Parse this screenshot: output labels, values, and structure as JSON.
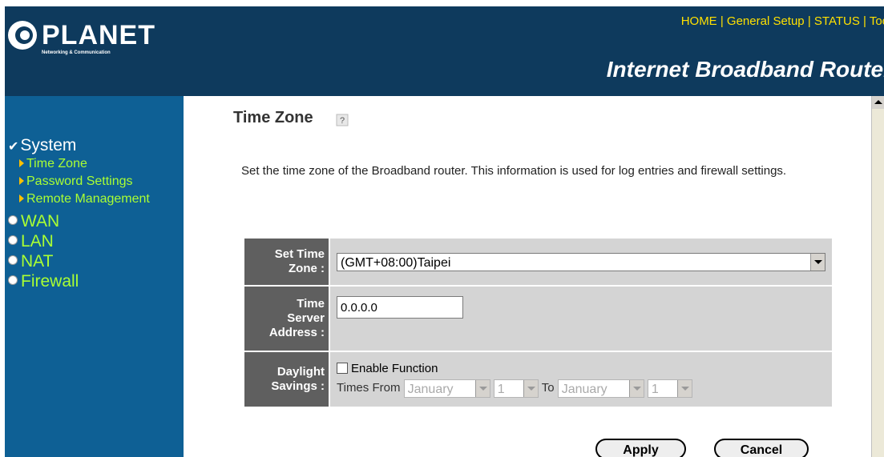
{
  "header": {
    "logo_text": "PLANET",
    "logo_subtext": "Networking & Communication",
    "nav": [
      "HOME",
      "General Setup",
      "STATUS",
      "Too"
    ],
    "nav_sep": " | ",
    "product_name": "Internet Broadband Router",
    "colors": {
      "background": "#0e3a5d",
      "nav": "#ffe000"
    }
  },
  "sidebar": {
    "system": "System",
    "system_items": [
      "Time Zone",
      "Password Settings",
      "Remote Management"
    ],
    "wan": "WAN",
    "lan": "LAN",
    "nat": "NAT",
    "firewall": "Firewall",
    "colors": {
      "background": "#0e6095",
      "active": "#aaff33"
    }
  },
  "main": {
    "title": "Time Zone",
    "help_icon": "help-icon",
    "description": "Set the time zone of the Broadband router. This information is used for log entries and firewall settings.",
    "form": {
      "tz_label_line1": "Set Time",
      "tz_label_line2": "Zone :",
      "tz_value": "(GMT+08:00)Taipei",
      "server_label_line1": "Time",
      "server_label_line2": "Server",
      "server_label_line3": "Address :",
      "server_value": "0.0.0.0",
      "dst_label_line1": "Daylight",
      "dst_label_line2": "Savings :",
      "dst_enable_label": "Enable Function",
      "dst_enabled": false,
      "times_from_label": "Times From",
      "from_month": "January",
      "from_day": "1",
      "to_label": "To",
      "to_month": "January",
      "to_day": "1"
    },
    "buttons": {
      "apply": "Apply",
      "cancel": "Cancel"
    }
  }
}
